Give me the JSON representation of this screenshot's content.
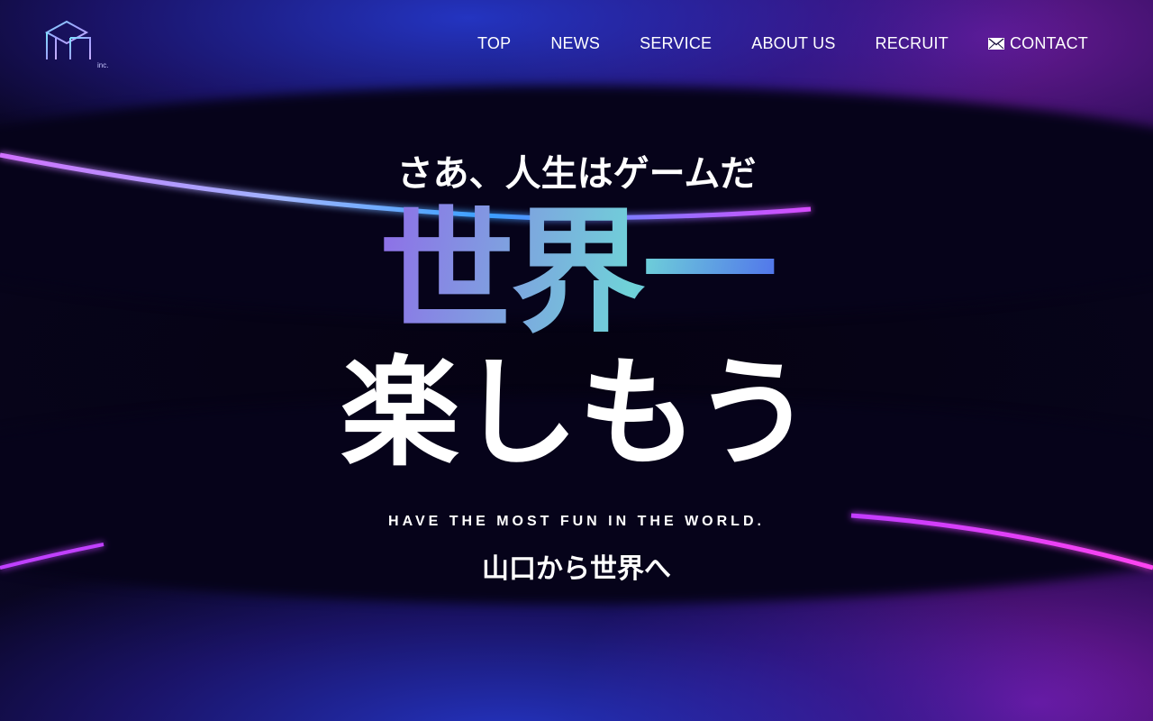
{
  "header": {
    "logo_text": "inc.",
    "nav": [
      {
        "label": "TOP"
      },
      {
        "label": "NEWS"
      },
      {
        "label": "SERVICE"
      },
      {
        "label": "ABOUT US"
      },
      {
        "label": "RECRUIT"
      },
      {
        "label": "CONTACT",
        "icon": "mail-icon"
      }
    ]
  },
  "hero": {
    "tagline": "さあ、人生はゲームだ",
    "headline_1": "世界一",
    "headline_2": "楽しもう",
    "subtitle": "HAVE THE MOST FUN IN THE WORLD.",
    "subline": "山口から世界へ"
  },
  "colors": {
    "background": "#06031a",
    "accent_blue": "#2b3fe0",
    "accent_purple": "#8a2be2",
    "accent_magenta": "#e040fb",
    "text": "#ffffff"
  }
}
